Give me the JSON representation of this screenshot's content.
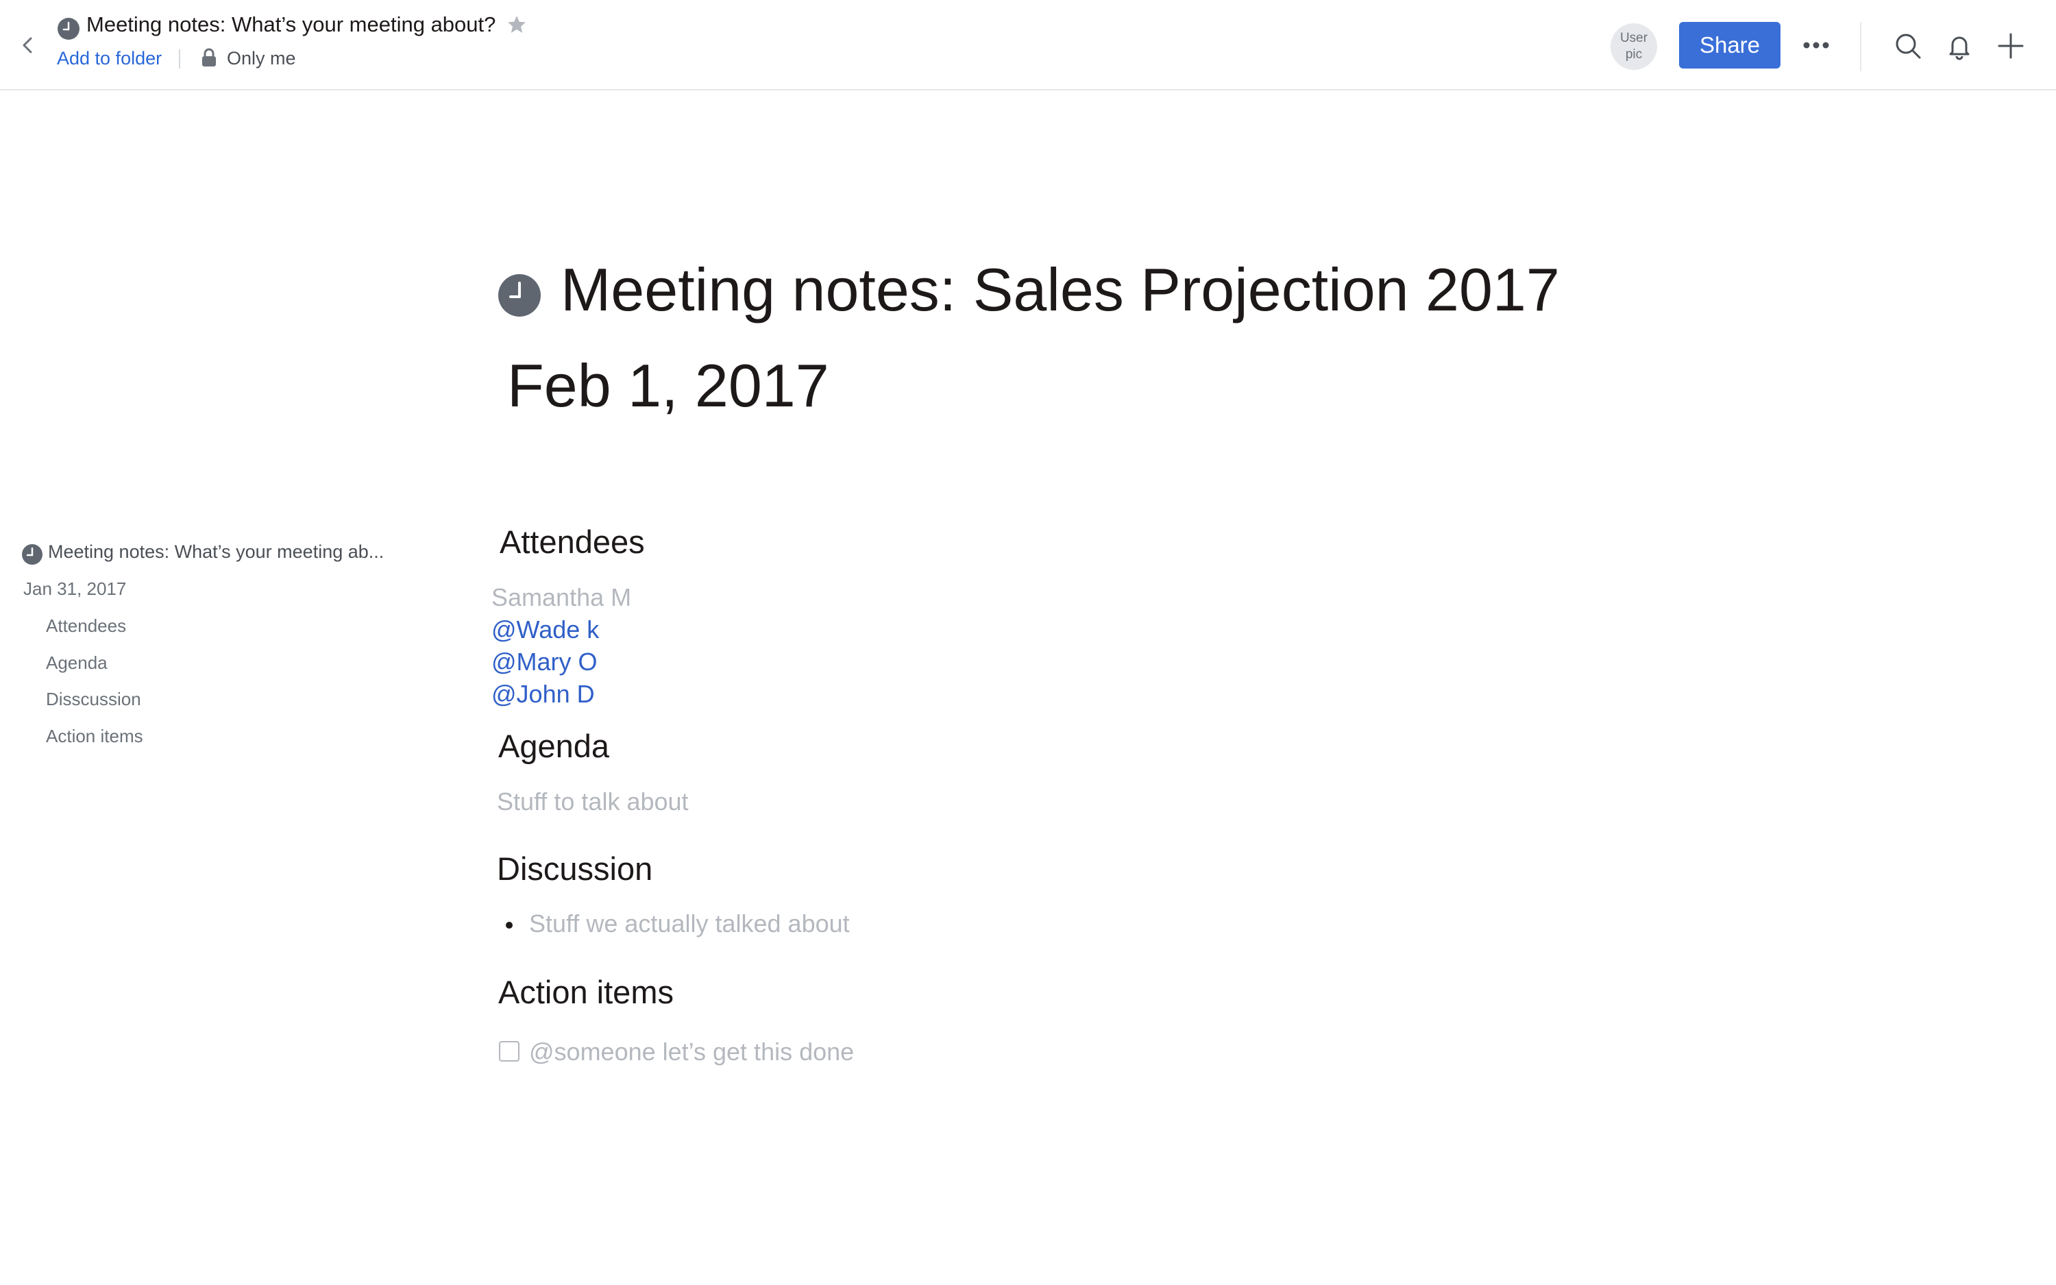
{
  "topbar": {
    "doc_title": "Meeting notes: What’s your meeting about?",
    "add_to_folder": "Add to folder",
    "privacy": "Only me",
    "avatar_line1": "User",
    "avatar_line2": "pic",
    "share_label": "Share",
    "icons": [
      "chevron-left-icon",
      "clock-icon",
      "star-icon",
      "lock-icon",
      "more-icon",
      "search-icon",
      "bell-icon",
      "plus-icon"
    ]
  },
  "toc": {
    "doc_label": "Meeting notes: What’s your meeting ab...",
    "date": "Jan 31, 2017",
    "items": [
      "Attendees",
      "Agenda",
      "Disscussion",
      "Action items"
    ]
  },
  "document": {
    "title": "Meeting notes: Sales Projection 2017",
    "date": "Feb 1, 2017",
    "attendees_heading": "Attendees",
    "attendees": [
      "Samantha M",
      "@Wade k",
      "@Mary O",
      "@John D"
    ],
    "agenda_heading": "Agenda",
    "agenda_text": "Stuff to talk about",
    "discussion_heading": "Discussion",
    "discussion_bullet": "Stuff we actually talked about",
    "action_heading": "Action items",
    "action_item": "@someone let’s get this done"
  },
  "colors": {
    "accent": "#3a6fd8",
    "link": "#2f5fc8",
    "placeholder": "#b4b8be",
    "text": "#1e1919",
    "clock": "#5f6670"
  }
}
